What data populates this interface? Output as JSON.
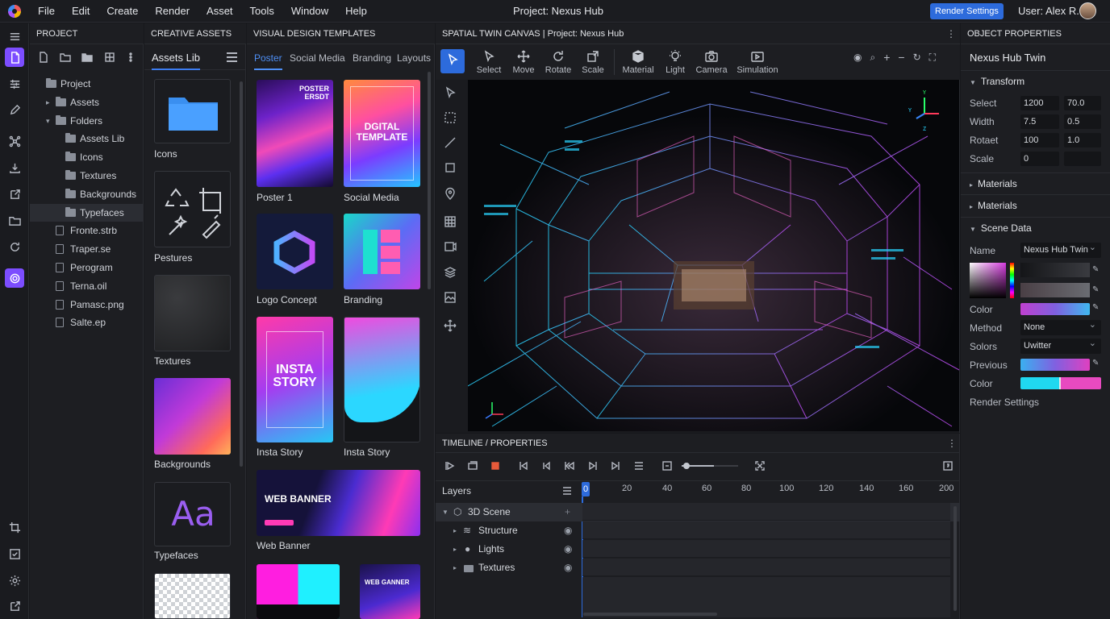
{
  "menubar": {
    "items": [
      "File",
      "Edit",
      "Create",
      "Render",
      "Asset",
      "Tools",
      "Window",
      "Help"
    ],
    "project_title": "Project: Nexus Hub",
    "render_settings": "Render Settings",
    "user": "User: Alex R."
  },
  "project_panel": {
    "title": "PROJECT",
    "tree": [
      {
        "label": "Project",
        "indent": 0,
        "caret": "",
        "icon": "folder"
      },
      {
        "label": "Assets",
        "indent": 1,
        "caret": "▸",
        "icon": "folder"
      },
      {
        "label": "Folders",
        "indent": 1,
        "caret": "▾",
        "icon": "folder"
      },
      {
        "label": "Assets Lib",
        "indent": 2,
        "caret": "",
        "icon": "folder"
      },
      {
        "label": "Icons",
        "indent": 2,
        "caret": "",
        "icon": "folder"
      },
      {
        "label": "Textures",
        "indent": 2,
        "caret": "",
        "icon": "folder"
      },
      {
        "label": "Backgrounds",
        "indent": 2,
        "caret": "",
        "icon": "folder"
      },
      {
        "label": "Typefaces",
        "indent": 2,
        "caret": "",
        "icon": "folder",
        "selected": true
      },
      {
        "label": "Fronte.strb",
        "indent": 1,
        "caret": "",
        "icon": "file"
      },
      {
        "label": "Traper.se",
        "indent": 1,
        "caret": "",
        "icon": "file"
      },
      {
        "label": "Perogram",
        "indent": 1,
        "caret": "",
        "icon": "file"
      },
      {
        "label": "Terna.oil",
        "indent": 1,
        "caret": "",
        "icon": "file"
      },
      {
        "label": "Pamasc.png",
        "indent": 1,
        "caret": "",
        "icon": "file"
      },
      {
        "label": "Salte.ep",
        "indent": 1,
        "caret": "",
        "icon": "file"
      }
    ]
  },
  "assets_panel": {
    "title": "CREATIVE ASSETS",
    "tab": "Assets Lib",
    "cards": [
      {
        "label": "Icons"
      },
      {
        "label": "Pestures"
      },
      {
        "label": "Textures"
      },
      {
        "label": "Backgrounds"
      },
      {
        "label": "Typefaces",
        "glyph": "Aa"
      }
    ]
  },
  "templates_panel": {
    "title": "VISUAL DESIGN TEMPLATES",
    "tabs": [
      "Poster",
      "Social Media",
      "Branding",
      "Layouts"
    ],
    "cards": [
      {
        "label": "Poster 1",
        "art_text": "POSTER ERSDT"
      },
      {
        "label": "Social Media",
        "art_text": "DGITAL TEMPLATE"
      },
      {
        "label": "Logo Concept"
      },
      {
        "label": "Branding"
      },
      {
        "label": "Insta Story",
        "art_text": "INSTA STORY"
      },
      {
        "label": "Insta Story"
      },
      {
        "label": "Web Banner",
        "art_text": "WEB BANNER"
      },
      {
        "label": "",
        "art_text": "WEB GANNER"
      }
    ]
  },
  "canvas_panel": {
    "title": "SPATIAL TWIN CANVAS | Project: Nexus Hub",
    "tools": [
      "Select",
      "Move",
      "Rotate",
      "Scale",
      "Material",
      "Light",
      "Camera",
      "Simulation"
    ]
  },
  "timeline_panel": {
    "title": "TIMELINE / PROPERTIES",
    "layers_label": "Layers",
    "ruler": [
      "0",
      "20",
      "40",
      "60",
      "80",
      "100",
      "120",
      "140",
      "160",
      "200"
    ],
    "layers": [
      {
        "label": "3D Scene",
        "icon": "cube-icon"
      },
      {
        "label": "Structure",
        "icon": "layers-icon"
      },
      {
        "label": "Lights",
        "icon": "bulb-icon"
      },
      {
        "label": "Textures",
        "icon": "folder-icon"
      }
    ]
  },
  "properties_panel": {
    "title": "OBJECT PROPERTIES",
    "object_name": "Nexus Hub Twin",
    "transform_label": "Transform",
    "transform_rows": [
      {
        "label": "Select",
        "a": "1200",
        "b": "70.0"
      },
      {
        "label": "Width",
        "a": "7.5",
        "b": "0.5"
      },
      {
        "label": "Rotaet",
        "a": "100",
        "b": "1.0"
      },
      {
        "label": "Scale",
        "a": "0",
        "b": ""
      }
    ],
    "materials_1": "Materials",
    "materials_2": "Materials",
    "scene_data": "Scene Data",
    "name_label": "Name",
    "name_value": "Nexus Hub Twin",
    "color_label": "Color",
    "method_label": "Method",
    "method_value": "None",
    "solors_label": "Solors",
    "solors_value": "Uwitter",
    "previous_label": "Previous",
    "color2_label": "Color",
    "render_settings": "Render Settings"
  }
}
